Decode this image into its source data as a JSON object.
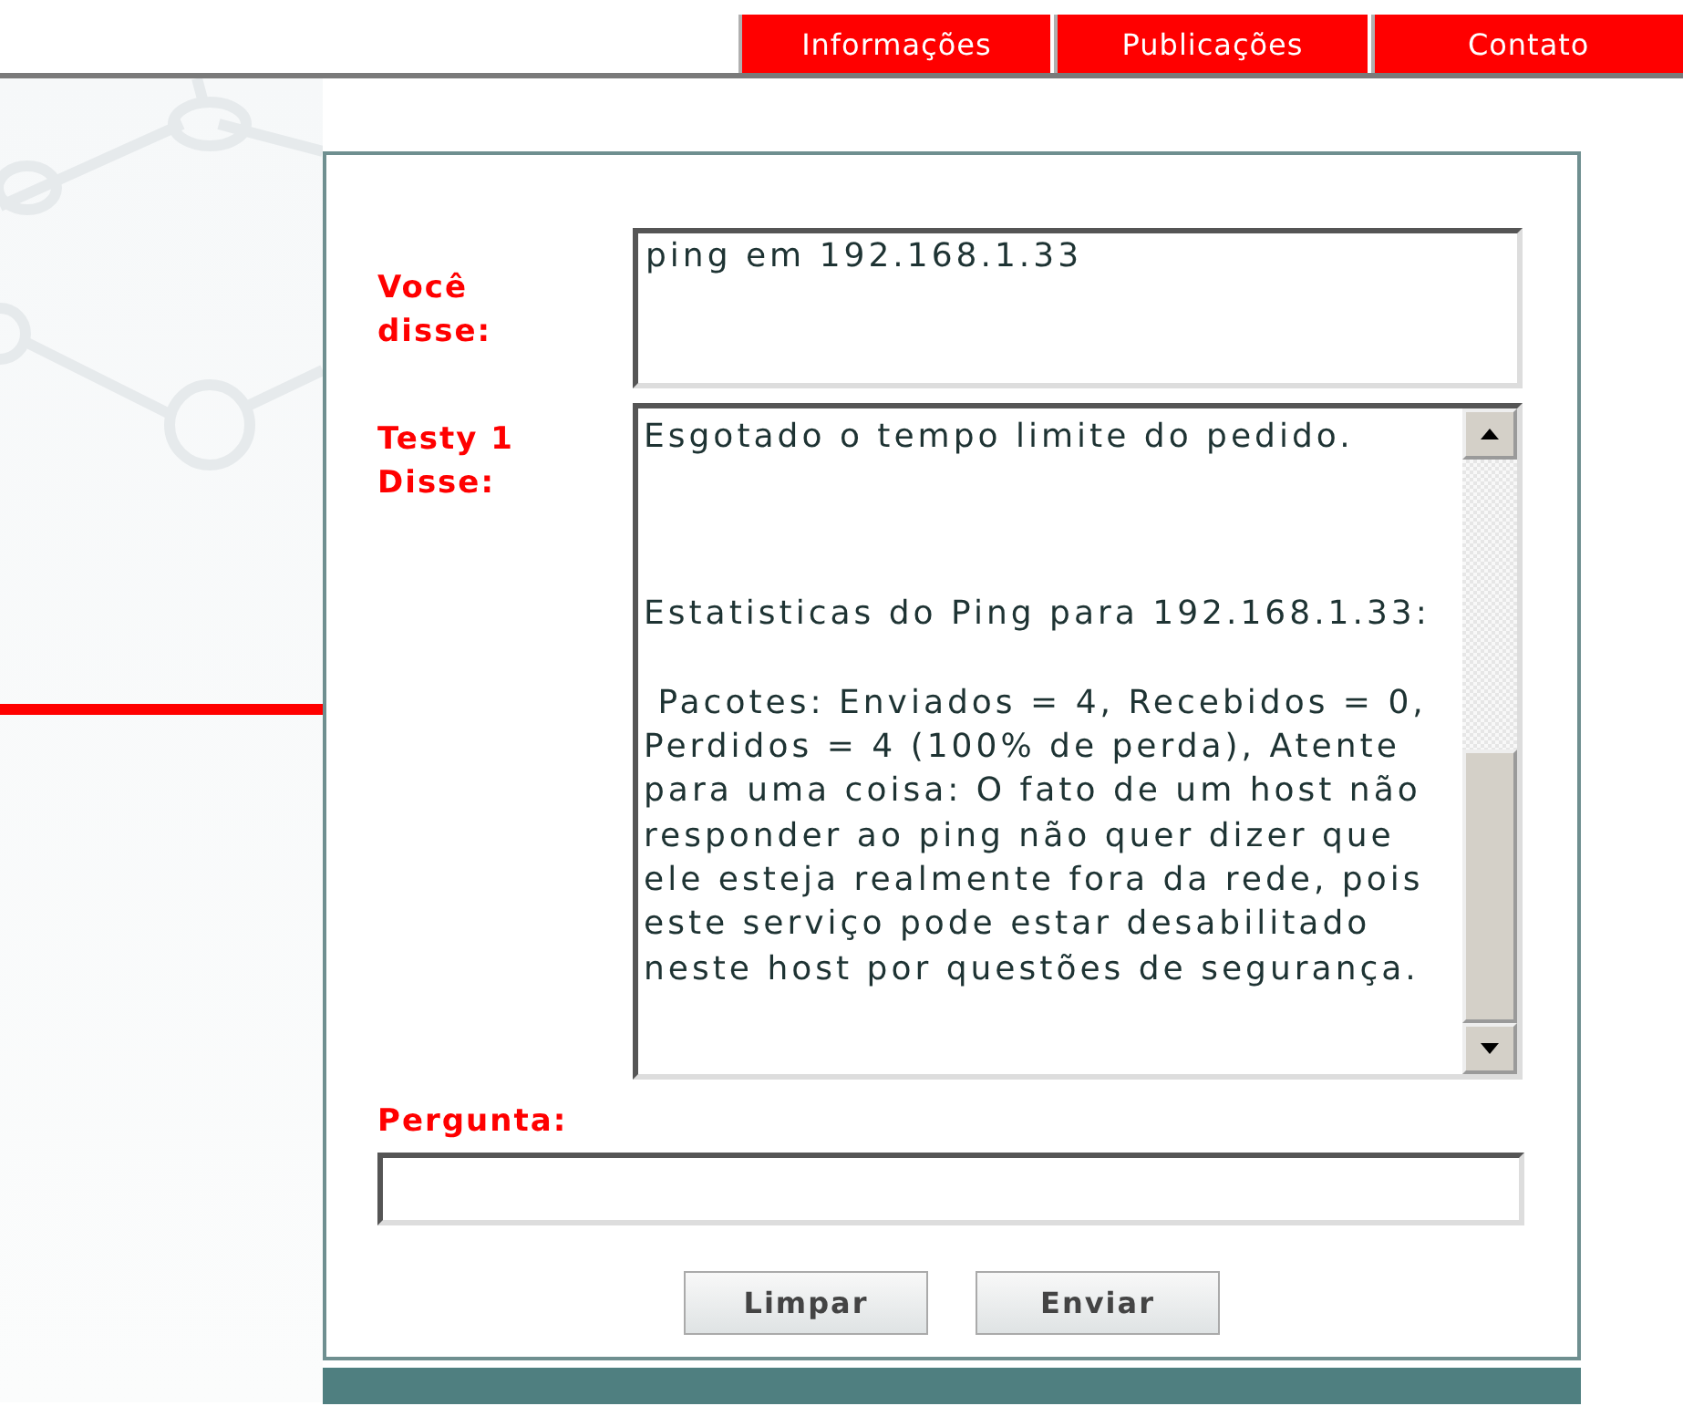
{
  "nav": {
    "tabs": [
      {
        "label": "Informações"
      },
      {
        "label": "Publicações"
      },
      {
        "label": "Contato"
      }
    ]
  },
  "chat": {
    "user_label": "Você disse:",
    "user_message": "ping em 192.168.1.33",
    "bot_label": "Testy 1 Disse:",
    "bot_reply": "Esgotado o tempo limite do pedido.\n\n\n\nEstatisticas do Ping para 192.168.1.33:\n\n Pacotes: Enviados = 4, Recebidos = 0, Perdidos = 4 (100% de perda), Atente para uma coisa: O fato de um host não responder ao ping não quer dizer que ele esteja realmente fora da rede, pois este serviço pode estar desabilitado neste host por questões de segurança.",
    "question_label": "Pergunta:"
  },
  "buttons": [
    {
      "label": "Limpar"
    },
    {
      "label": "Enviar"
    }
  ]
}
